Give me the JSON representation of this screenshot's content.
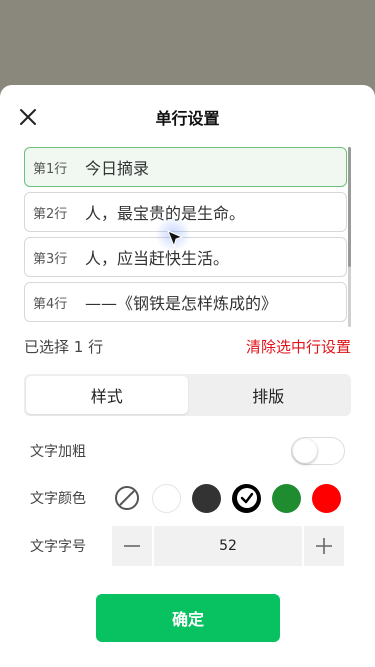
{
  "dialog": {
    "title": "单行设置",
    "close_icon": "close-icon"
  },
  "lines": [
    {
      "no": "第1行",
      "text": "今日摘录",
      "selected": true
    },
    {
      "no": "第2行",
      "text": "人，最宝贵的是生命。",
      "selected": false
    },
    {
      "no": "第3行",
      "text": "人，应当赶快生活。",
      "selected": false
    },
    {
      "no": "第4行",
      "text": "——《钢铁是怎样炼成的》",
      "selected": false
    }
  ],
  "selection": {
    "count_text": "已选择 1 行",
    "clear_label": "清除选中行设置"
  },
  "tabs": [
    {
      "label": "样式",
      "active": true
    },
    {
      "label": "排版",
      "active": false
    }
  ],
  "style": {
    "bold_label": "文字加粗",
    "bold_on": false,
    "color_label": "文字颜色",
    "colors": [
      {
        "name": "none",
        "hex": "",
        "icon": "no-color-icon"
      },
      {
        "name": "white",
        "hex": "#ffffff"
      },
      {
        "name": "dark-gray",
        "hex": "#333333"
      },
      {
        "name": "black",
        "hex": "#000000",
        "selected": true,
        "icon": "check-icon"
      },
      {
        "name": "green",
        "hex": "#1f8c2f"
      },
      {
        "name": "red",
        "hex": "#ff0000"
      }
    ],
    "size_label": "文字字号",
    "size_value": "52"
  },
  "confirm_label": "确定",
  "colors": {
    "accent": "#08c160",
    "danger": "#e0151b",
    "selected_border": "#6cc17a"
  }
}
